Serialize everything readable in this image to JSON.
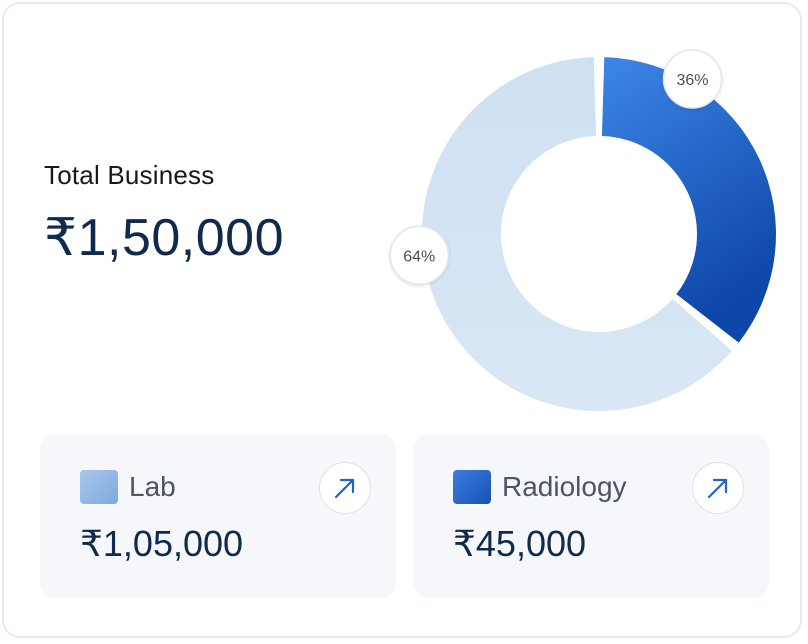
{
  "total": {
    "label": "Total Business",
    "value": "₹1,50,000"
  },
  "chart_data": {
    "type": "pie",
    "title": "",
    "slices": [
      {
        "label": "Radiology",
        "percent": 36,
        "display": "36%",
        "color": "#2563c9"
      },
      {
        "label": "Lab",
        "percent": 64,
        "display": "64%",
        "color": "#d6e4f3"
      }
    ]
  },
  "tiles": [
    {
      "name": "Lab",
      "value": "₹1,05,000",
      "icon": "arrow-up-right-icon"
    },
    {
      "name": "Radiology",
      "value": "₹45,000",
      "icon": "arrow-up-right-icon"
    }
  ],
  "colors": {
    "accent_dark": "#0f2a4a",
    "radiology": "#2563c9",
    "lab": "#d6e4f3",
    "arrow": "#2563c9"
  }
}
